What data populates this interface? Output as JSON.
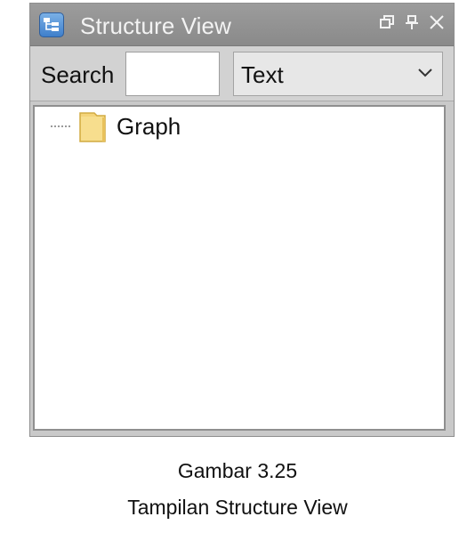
{
  "window": {
    "title": "Structure View",
    "icons": {
      "app": "structure-view-icon",
      "restore": "restore-window-icon",
      "pin": "pin-icon",
      "close": "close-icon"
    }
  },
  "search": {
    "label": "Search",
    "value": "",
    "placeholder": ""
  },
  "filter": {
    "selected": "Text",
    "chevron_icon": "chevron-down-icon"
  },
  "tree": {
    "nodes": [
      {
        "label": "Graph",
        "icon": "folder-icon"
      }
    ]
  },
  "caption": {
    "figure": "Gambar 3.25",
    "text": "Tampilan Structure View"
  },
  "colors": {
    "titlebar": "#8f8f8f",
    "toolbar": "#d2d2d2",
    "folder": "#f4d47a"
  }
}
